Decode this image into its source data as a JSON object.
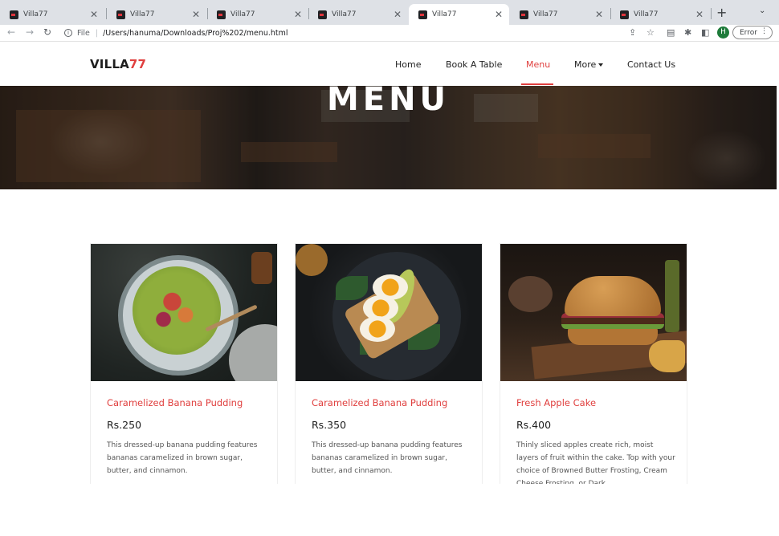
{
  "browser": {
    "tabs": [
      {
        "label": "Villa77",
        "active": false
      },
      {
        "label": "Villa77",
        "active": false
      },
      {
        "label": "Villa77",
        "active": false
      },
      {
        "label": "Villa77",
        "active": false
      },
      {
        "label": "Villa77",
        "active": true
      },
      {
        "label": "Villa77",
        "active": false
      },
      {
        "label": "Villa77",
        "active": false
      }
    ],
    "address": {
      "scheme_label": "File",
      "url": "/Users/hanuma/Downloads/Proj%202/menu.html"
    },
    "profile_initial": "H",
    "error_label": "Error"
  },
  "site": {
    "logo": {
      "text": "VILLA",
      "accent": "77"
    },
    "nav": [
      {
        "label": "Home",
        "active": false
      },
      {
        "label": "Book A Table",
        "active": false
      },
      {
        "label": "Menu",
        "active": true
      },
      {
        "label": "More",
        "active": false,
        "dropdown": true
      },
      {
        "label": "Contact Us",
        "active": false
      }
    ],
    "hero_title": "MENU",
    "accent_color": "#e0403f",
    "cards": [
      {
        "image": "salad-bowl-photo",
        "title": "Caramelized Banana Pudding",
        "price": "Rs.250",
        "description": "This dressed-up banana pudding features bananas caramelized in brown sugar, butter, and cinnamon."
      },
      {
        "image": "egg-toast-photo",
        "title": "Caramelized Banana Pudding",
        "price": "Rs.350",
        "description": "This dressed-up banana pudding features bananas caramelized in brown sugar, butter, and cinnamon."
      },
      {
        "image": "burger-photo",
        "title": "Fresh Apple Cake",
        "price": "Rs.400",
        "description": "Thinly sliced apples create rich, moist layers of fruit within the cake. Top with your choice of Browned Butter Frosting, Cream Cheese Frosting, or Dark"
      }
    ]
  }
}
